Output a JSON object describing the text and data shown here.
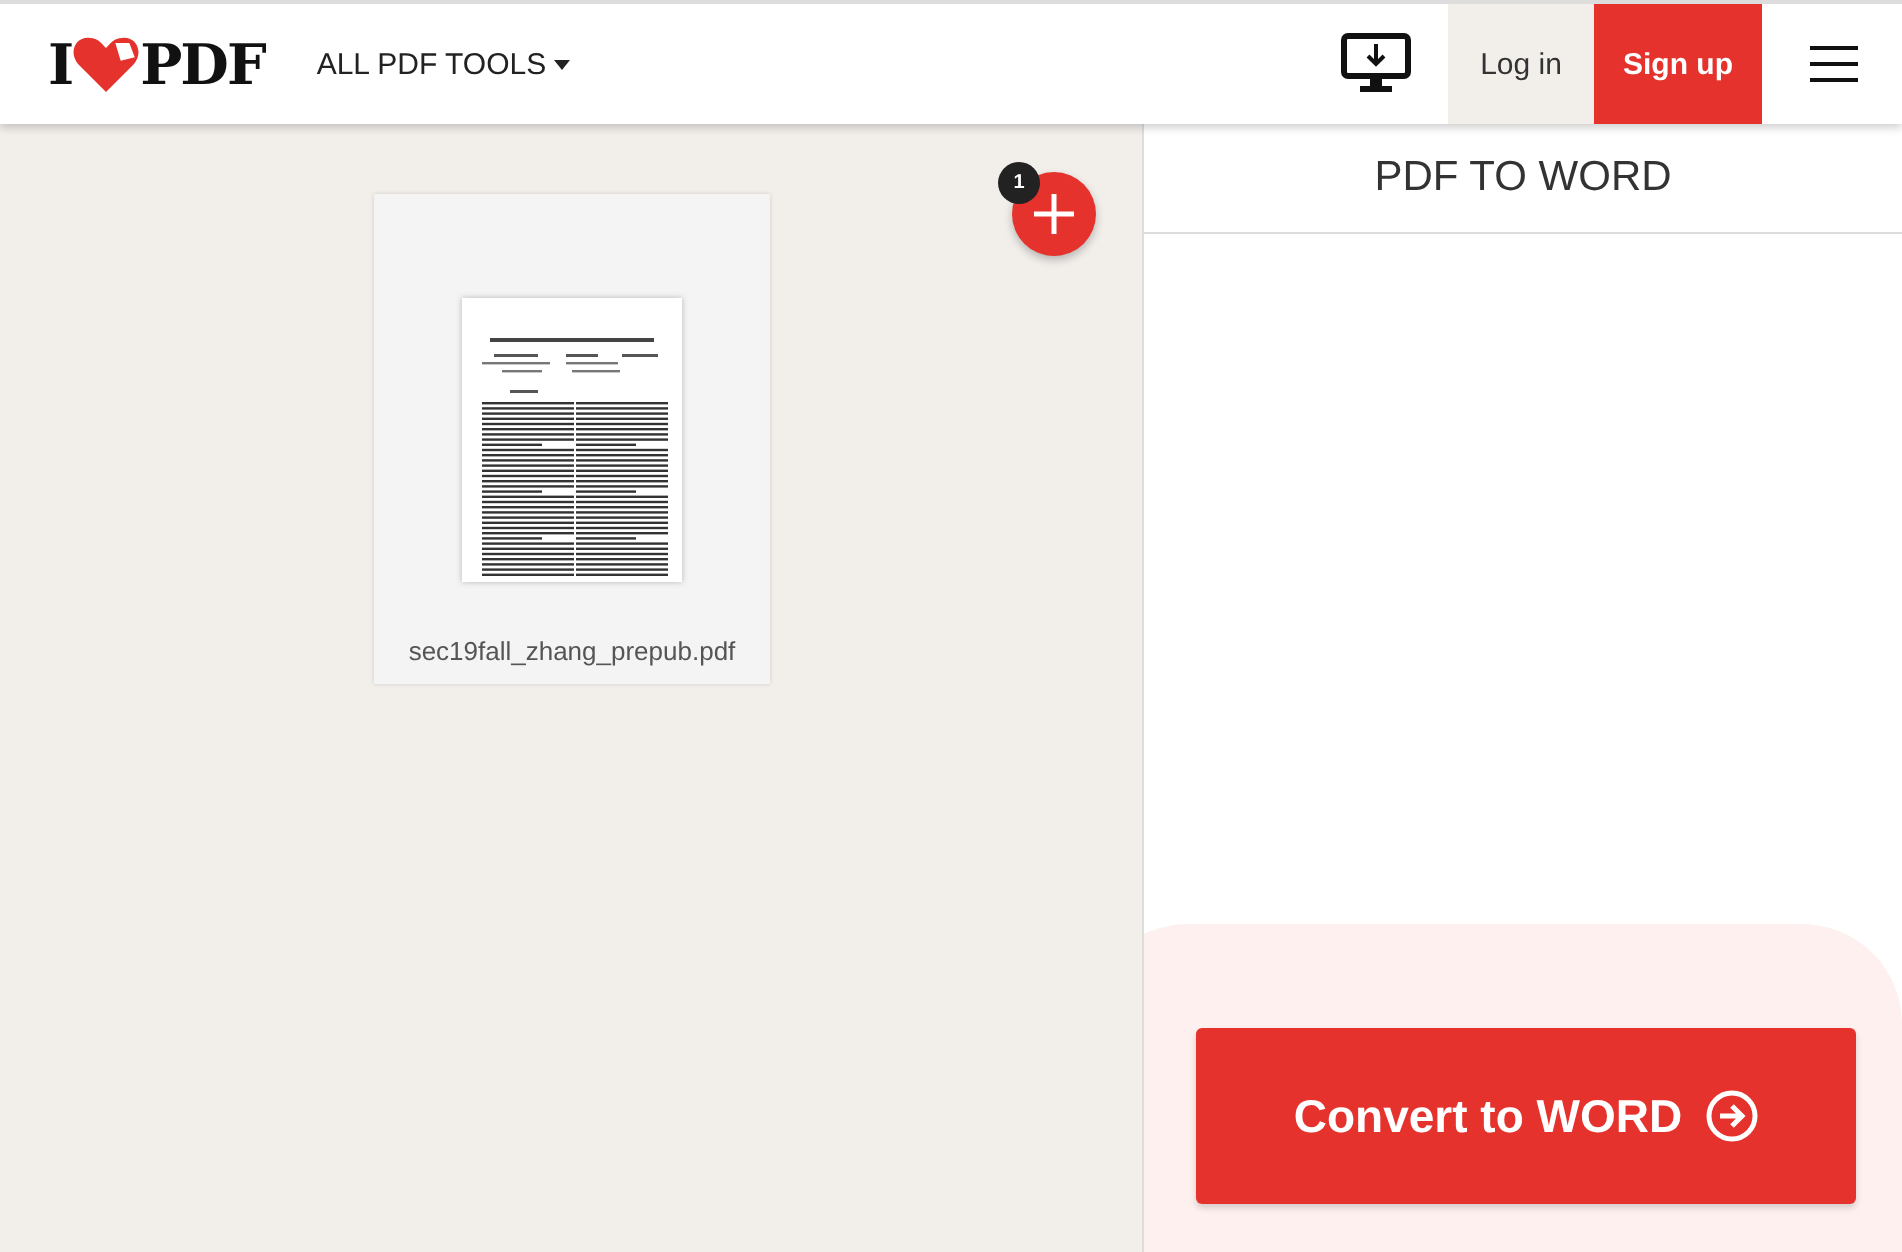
{
  "header": {
    "logo": {
      "left": "I",
      "right": "PDF"
    },
    "tools_menu": {
      "label": "ALL PDF TOOLS",
      "expanded": false
    },
    "login": "Log in",
    "signup": "Sign up"
  },
  "files": [
    {
      "name": "sec19fall_zhang_prepub.pdf"
    }
  ],
  "add_button": {
    "count": "1"
  },
  "sidebar": {
    "title": "PDF TO WORD",
    "action": "Convert to WORD"
  }
}
